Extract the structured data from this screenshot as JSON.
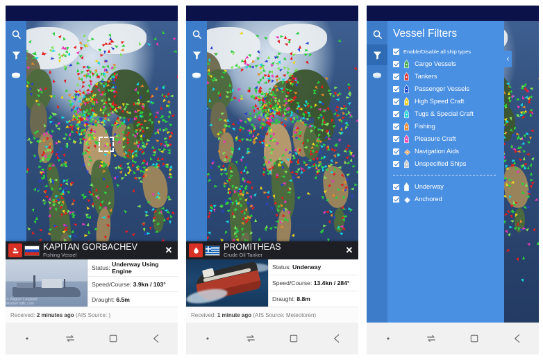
{
  "app": {
    "name": "MarineTraffic"
  },
  "rail": {
    "items": [
      {
        "name": "search-icon",
        "label": "Search"
      },
      {
        "name": "filter-icon",
        "label": "Filters"
      },
      {
        "name": "layers-icon",
        "label": "Map Layers"
      }
    ]
  },
  "panels": [
    {
      "id": "panel-vessel-kapitan",
      "active_rail_index": -1,
      "selection_marquee": true,
      "info_card": {
        "vessel_name": "KAPITAN GORBACHEV",
        "vessel_type": "Fishing Vessel",
        "flag": "ru",
        "type_icon": "fishing-vessel-icon",
        "photo": "fishing",
        "photo_credit_line1": "© Wagner Lungstad",
        "photo_credit_line2": "MarineTraffic.com",
        "close_label": "✕",
        "rows": [
          {
            "label": "Status:",
            "value": "Underway Using Engine"
          },
          {
            "label": "Speed/Course:",
            "value": "3.9kn / 103°"
          },
          {
            "label": "Draught:",
            "value": "6.5m"
          }
        ],
        "footer_prefix": "Received:",
        "footer_value": "2 minutes ago",
        "footer_suffix": "(AIS Source: )"
      }
    },
    {
      "id": "panel-vessel-promitheas",
      "active_rail_index": -1,
      "selection_marquee": false,
      "info_card": {
        "vessel_name": "PROMITHEAS",
        "vessel_type": "Crude Oil Tanker",
        "flag": "gr",
        "type_icon": "crude-oil-tanker-icon",
        "photo": "tanker",
        "photo_credit_line1": "",
        "photo_credit_line2": "",
        "close_label": "✕",
        "rows": [
          {
            "label": "Status:",
            "value": "Underway"
          },
          {
            "label": "Speed/Course:",
            "value": "13.4kn / 284°"
          },
          {
            "label": "Draught:",
            "value": "8.8m"
          }
        ],
        "footer_prefix": "Received:",
        "footer_value": "1 minute ago",
        "footer_suffix": "(AIS Source: Meteotoren)"
      }
    },
    {
      "id": "panel-vessel-filters",
      "active_rail_index": 1,
      "selection_marquee": false,
      "info_card": null
    }
  ],
  "filters": {
    "title": "Vessel Filters",
    "collapse_icon": "chevron-left-icon",
    "master": {
      "label": "Enable/Disable all ship types",
      "checked": true
    },
    "ship_types": [
      {
        "label": "Cargo Vessels",
        "checked": true,
        "icon": "ship-icon",
        "color": "#4caf50"
      },
      {
        "label": "Tankers",
        "checked": true,
        "icon": "ship-icon",
        "color": "#e53935"
      },
      {
        "label": "Passenger Vessels",
        "checked": true,
        "icon": "ship-icon",
        "color": "#1f4fd8"
      },
      {
        "label": "High Speed Craft",
        "checked": true,
        "icon": "ship-icon",
        "color": "#f0d020"
      },
      {
        "label": "Tugs & Special Craft",
        "checked": true,
        "icon": "ship-icon",
        "color": "#27d6d6"
      },
      {
        "label": "Fishing",
        "checked": true,
        "icon": "ship-icon",
        "color": "#f08a28"
      },
      {
        "label": "Pleasure Craft",
        "checked": true,
        "icon": "ship-icon",
        "color": "#f050b0"
      },
      {
        "label": "Navigation Aids",
        "checked": true,
        "icon": "diamond-icon",
        "color": "#f0a050"
      },
      {
        "label": "Unspecified Ships",
        "checked": true,
        "icon": "ship-icon",
        "color": "#c9cdd2"
      }
    ],
    "statuses": [
      {
        "label": "Underway",
        "checked": true,
        "icon": "ship-icon",
        "color": "#ffffff"
      },
      {
        "label": "Anchored",
        "checked": true,
        "icon": "diamond-icon",
        "color": "#ffffff"
      }
    ]
  },
  "navbar": {
    "buttons": [
      {
        "name": "nav-dot-button",
        "icon": "dot-icon"
      },
      {
        "name": "nav-recents-button",
        "icon": "swap-arrows-icon"
      },
      {
        "name": "nav-home-button",
        "icon": "square-icon"
      },
      {
        "name": "nav-back-button",
        "icon": "back-arrow-icon"
      }
    ]
  },
  "colors": {
    "status_bar": "#0b1149",
    "rail": "#3d7cc9",
    "filter_panel": "#4a90e2",
    "card_header": "#1d1f24",
    "nav_bar": "#f1f1f1"
  }
}
